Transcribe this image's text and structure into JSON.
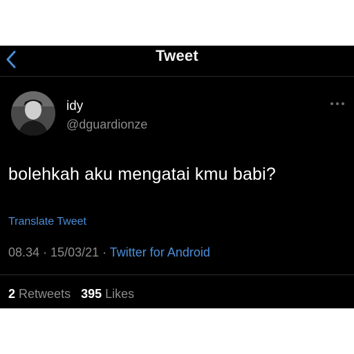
{
  "header": {
    "title": "Tweet",
    "back_icon": "chevron-left-icon"
  },
  "author": {
    "name": "idy",
    "handle": "@dguardionze",
    "avatar": "avatar-photo"
  },
  "more_icon": "more-horizontal-icon",
  "tweet": {
    "text": "bolehkah aku mengatai kmu babi?"
  },
  "translate_label": "Translate Tweet",
  "meta": {
    "time": "08.34",
    "separator1": " · ",
    "date": "15/03/21",
    "separator2": " · ",
    "source": "Twitter for Android"
  },
  "stats": {
    "retweets_count": "2",
    "retweets_label": "Retweets",
    "likes_count": "395",
    "likes_label": "Likes"
  },
  "colors": {
    "background": "#000000",
    "accent": "#4a8ed8",
    "secondary_text": "#8c8c8c"
  }
}
